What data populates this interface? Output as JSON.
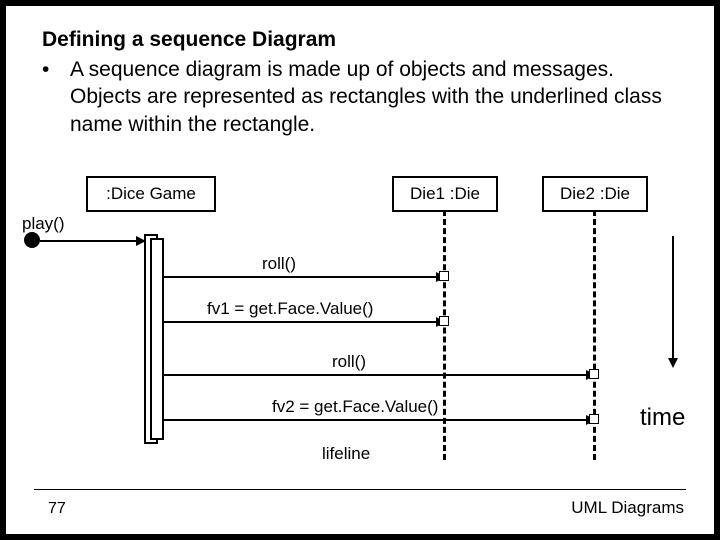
{
  "heading": "Defining a sequence Diagram",
  "bullet_dot": "•",
  "bullet": "A sequence diagram is made up of objects and messages. Objects are represented as rectangles with the underlined class name within the rectangle.",
  "objects": {
    "dicegame": ":Dice Game",
    "die1": "Die1 :Die",
    "die2": "Die2 :Die"
  },
  "messages": {
    "play": "play()",
    "roll1": "roll()",
    "fv1": "fv1 = get.Face.Value()",
    "roll2": "roll()",
    "fv2": "fv2 = get.Face.Value()"
  },
  "labels": {
    "time": "time",
    "lifeline": "lifeline"
  },
  "footer": {
    "page": "77",
    "right": "UML Diagrams"
  }
}
